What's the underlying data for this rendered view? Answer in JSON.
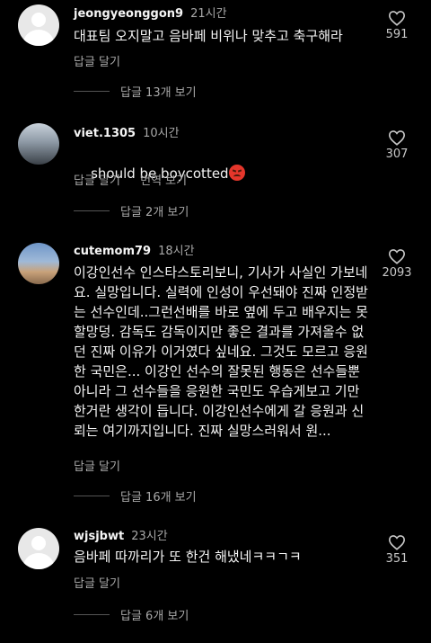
{
  "comments": [
    {
      "username": "jeongyeonggon9",
      "time": "21시간",
      "text": "대표팀 오지말고 음바페 비위나 맞추고 축구해라",
      "actions": [
        "답글 달기"
      ],
      "likes": "591",
      "replies_label": "답글 13개 보기",
      "avatar": "default-avatar"
    },
    {
      "username": "viet.1305",
      "time": "10시간",
      "text": "should be boycotted",
      "emoji": "angry-face-emoji",
      "actions": [
        "답글 달기",
        "번역 보기"
      ],
      "likes": "307",
      "replies_label": "답글 2개 보기",
      "avatar": "photo-avatar"
    },
    {
      "username": "cutemom79",
      "time": "18시간",
      "text": "이강인선수 인스타스토리보니, 기사가 사실인 가보네요. 실망입니다. 실력에 인성이 우선돼야 진짜 인정받는 선수인데..그런선배를 바로 옆에 두고 배우지는 못할망덩. 감독도 감독이지만 좋은 결과를 가져올수 없던 진짜 이유가 이거였다 싶네요. 그것도 모르고 응원한 국민은... 이강인 선수의 잘못된 행동은 선수들뿐아니라 그 선수들을 응원한 국민도 우습게보고 기만한거란 생각이 듭니다. 이강인선수에게 갈 응원과 신뢰는 여기까지입니다. 진짜 실망스러워서 원...",
      "actions": [
        "답글 달기"
      ],
      "likes": "2093",
      "replies_label": "답글 16개 보기",
      "avatar": "photo-avatar"
    },
    {
      "username": "wjsjbwt",
      "time": "23시간",
      "text": "음바페 따까리가 또 한건 해냈네ㅋㅋㄱㅋ",
      "actions": [
        "답글 달기"
      ],
      "likes": "351",
      "replies_label": "답글 6개 보기",
      "avatar": "default-avatar"
    }
  ],
  "colors": {
    "background": "#000000",
    "text": "#f5f5f5",
    "secondary": "#a8a8a8"
  }
}
